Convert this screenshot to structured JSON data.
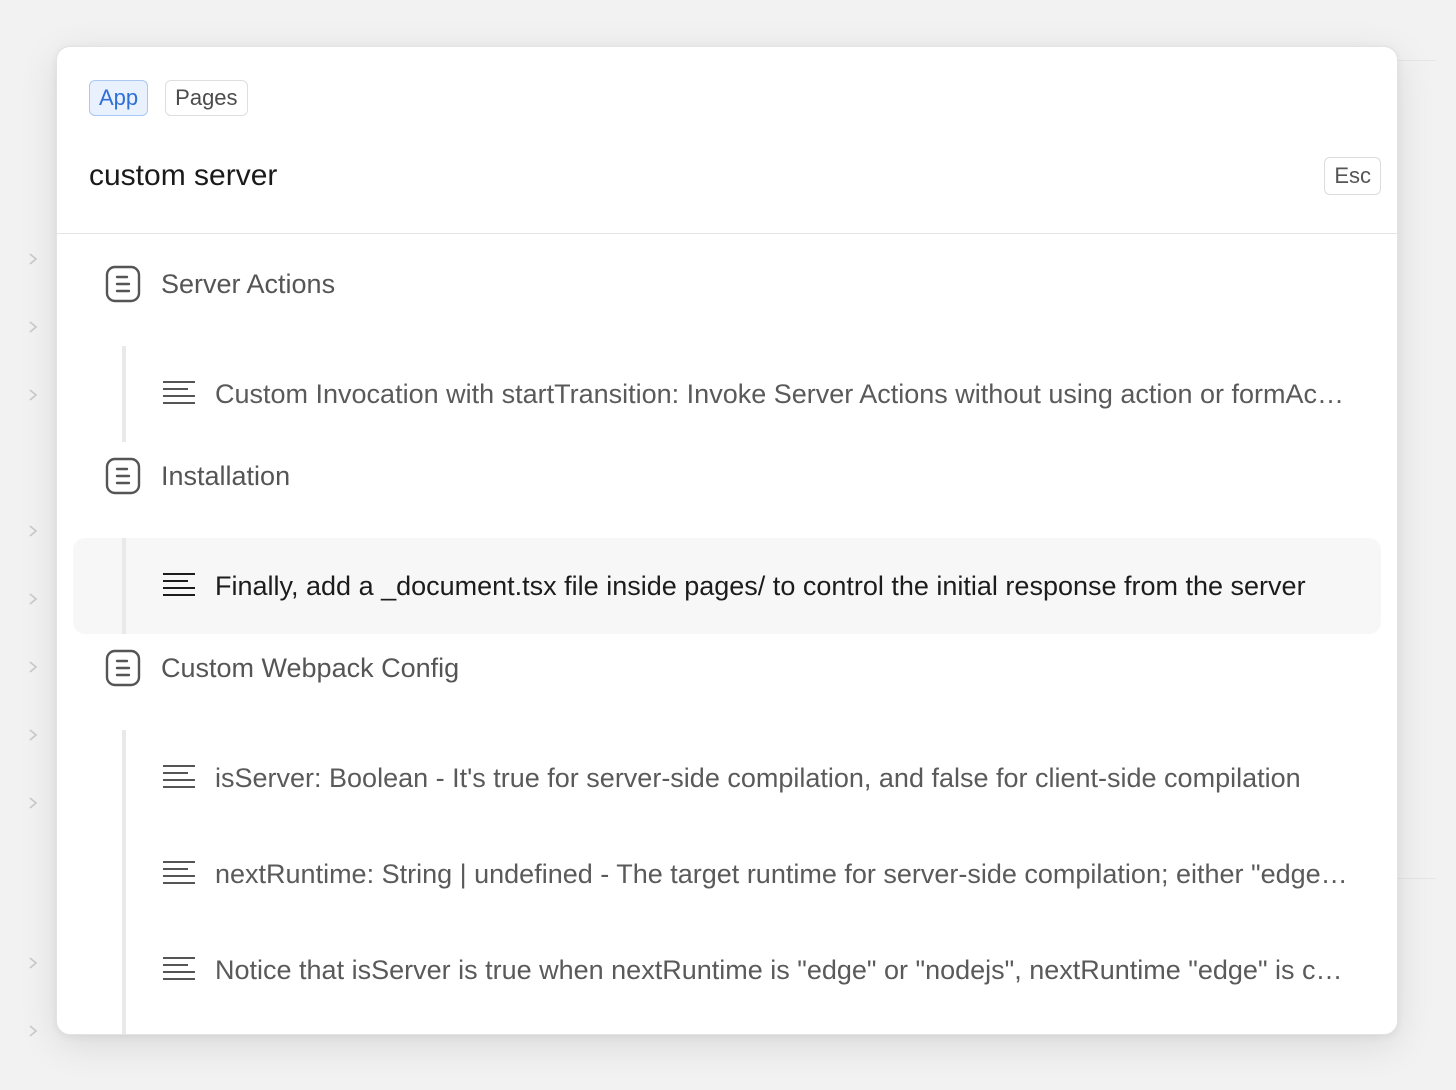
{
  "tabs": [
    {
      "label": "App",
      "active": true
    },
    {
      "label": "Pages",
      "active": false
    }
  ],
  "search": {
    "value": "custom server",
    "esc_label": "Esc"
  },
  "groups": [
    {
      "title": "Server Actions",
      "items": [
        "Custom Invocation with startTransition: Invoke Server Actions without using action or formAction"
      ]
    },
    {
      "title": "Installation",
      "items": [
        "Finally, add a _document.tsx file inside pages/ to control the initial response from the server"
      ]
    },
    {
      "title": "Custom Webpack Config",
      "items": [
        "isServer: Boolean - It's true for server-side compilation, and false for client-side compilation",
        "nextRuntime: String | undefined - The target runtime for server-side compilation; either \"edge\" or \"nodejs\"",
        "Notice that isServer is true when nextRuntime is \"edge\" or \"nodejs\", nextRuntime \"edge\" is currently for middleware and Server Components in edge runtime only."
      ]
    }
  ],
  "highlighted_item": "Finally, add a _document.tsx file inside pages/ to control the initial response from the server",
  "colors": {
    "accent": "#2f6fd6",
    "accent_bg": "#e8f1fd",
    "highlight_bg": "#f7f7f7"
  }
}
